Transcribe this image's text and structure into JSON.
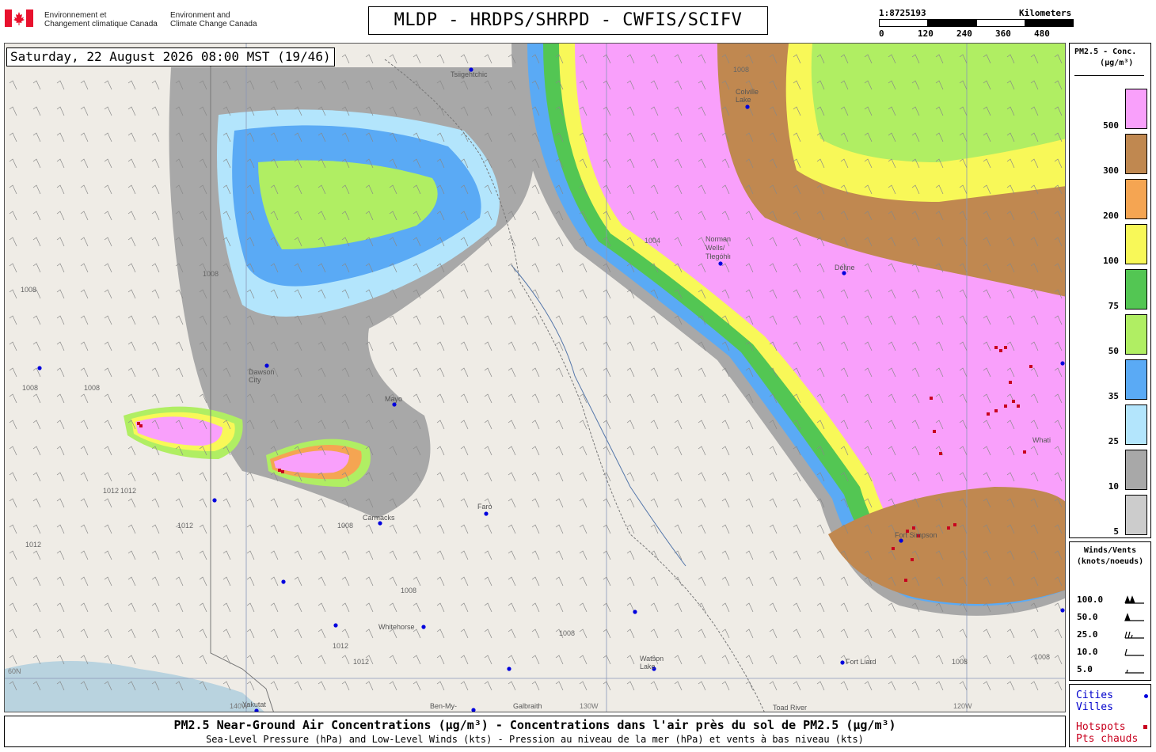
{
  "header": {
    "gov_fr_line1": "Environnement et",
    "gov_fr_line2": "Changement climatique Canada",
    "gov_en_line1": "Environment and",
    "gov_en_line2": "Climate Change Canada",
    "title": "MLDP - HRDPS/SHRPD - CWFIS/SCIFV",
    "scale_ratio": "1:8725193",
    "scale_units": "Kilometers",
    "scale_ticks": [
      "0",
      "120",
      "240",
      "360",
      "480"
    ]
  },
  "map": {
    "timestamp": "Saturday, 22 August 2026 08:00 MST (19/46)",
    "colors": {
      "land": "#efece6",
      "water": "#b9d3df",
      "pm_5": "#cccccc",
      "pm_10": "#a8a8a8",
      "pm_25": "#b3e5fc",
      "pm_35": "#5aaaf5",
      "pm_50": "#b0ee63",
      "pm_75": "#53c653",
      "pm_100": "#f8f858",
      "pm_200": "#f5a552",
      "pm_300": "#c08850",
      "pm_500": "#f9a0fb",
      "hotspot": "#c8001e",
      "city": "#0000dd"
    },
    "cities": [
      {
        "name": "Tsiigehtchic"
      },
      {
        "name": "Colville Lake"
      },
      {
        "name": "Norman Wells/ Tłegóhłı"
      },
      {
        "name": "Deline"
      },
      {
        "name": "Dawson City"
      },
      {
        "name": "Mayo"
      },
      {
        "name": "Faro"
      },
      {
        "name": "Carmacks"
      },
      {
        "name": "Fort Simpson"
      },
      {
        "name": "Whitehorse"
      },
      {
        "name": "Watson Lake"
      },
      {
        "name": "Fort Liard"
      },
      {
        "name": "Yakutat"
      },
      {
        "name": "Ben-My-"
      },
      {
        "name": "Galbraith"
      },
      {
        "name": "Toad River"
      },
      {
        "name": "Whati"
      }
    ],
    "isobar_labels": [
      "1008",
      "1008",
      "1008",
      "1008",
      "1012",
      "1012",
      "1012",
      "1012",
      "1008",
      "1008",
      "1004",
      "1008",
      "1008",
      "1008",
      "1008",
      "1012",
      "1012"
    ],
    "graticule_labels": [
      "60N",
      "130W",
      "120W",
      "140W"
    ]
  },
  "legend": {
    "pm_title_line1": "PM2.5 - Conc.",
    "pm_title_line2": "(µg/m³)",
    "pm_levels": [
      {
        "label": "500",
        "color": "#f9a0fb"
      },
      {
        "label": "300",
        "color": "#c08850"
      },
      {
        "label": "200",
        "color": "#f5a552"
      },
      {
        "label": "100",
        "color": "#f8f858"
      },
      {
        "label": "75",
        "color": "#53c653"
      },
      {
        "label": "50",
        "color": "#b0ee63"
      },
      {
        "label": "35",
        "color": "#5aaaf5"
      },
      {
        "label": "25",
        "color": "#b3e5fc"
      },
      {
        "label": "10",
        "color": "#a8a8a8"
      },
      {
        "label": "5",
        "color": "#cccccc"
      }
    ],
    "wind_title_line1": "Winds/Vents",
    "wind_title_line2": "(knots/noeuds)",
    "wind_levels": [
      "100.0",
      "50.0",
      "25.0",
      "10.0",
      "5.0"
    ],
    "cities_line1": "Cities",
    "cities_line2": "Villes",
    "hotspots_line1": "Hotspots",
    "hotspots_line2": "Pts chauds"
  },
  "footer": {
    "line1": "PM2.5 Near-Ground Air Concentrations (µg/m³) - Concentrations dans l'air près du sol de PM2.5 (µg/m³)",
    "line2": "Sea-Level Pressure (hPa) and Low-Level Winds (kts) - Pression au niveau de la mer (hPa) et vents à bas niveau (kts)"
  }
}
